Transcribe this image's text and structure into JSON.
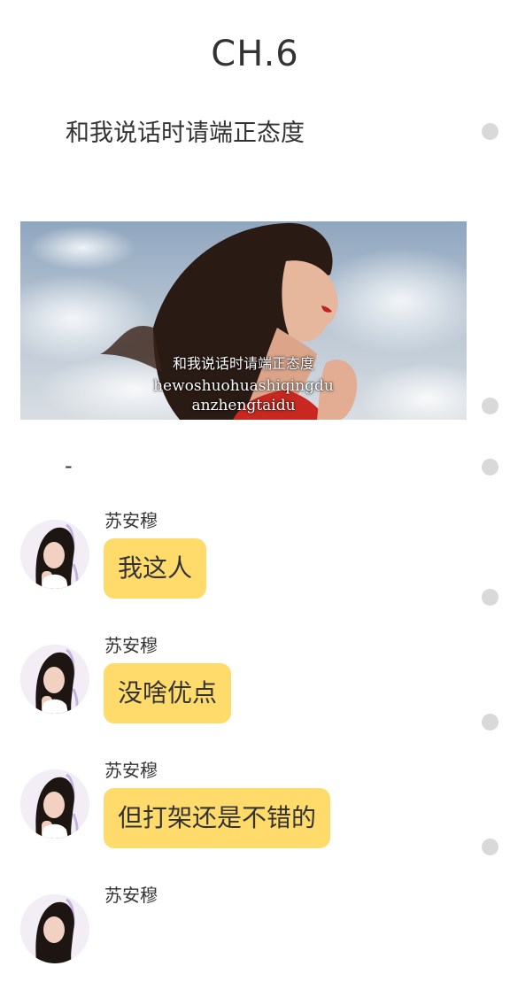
{
  "chapter": {
    "title": "CH.6"
  },
  "intro_text": "和我说话时请端正态度",
  "meme": {
    "caption_cn": "和我说话时请端正态度",
    "caption_pinyin_1": "hewoshuohuashiqingdu",
    "caption_pinyin_2": "anzhengtaidu"
  },
  "divider_text": "-",
  "messages": [
    {
      "sender": "苏安穆",
      "text": "我这人"
    },
    {
      "sender": "苏安穆",
      "text": "没啥优点"
    },
    {
      "sender": "苏安穆",
      "text": "但打架还是不错的"
    },
    {
      "sender": "苏安穆",
      "text": ""
    }
  ],
  "colors": {
    "bubble": "#ffdb6b",
    "dot": "#d9d9d9",
    "text": "#333333"
  },
  "icons": {
    "comment_dot": "comment-dot-icon",
    "avatar": "avatar"
  }
}
